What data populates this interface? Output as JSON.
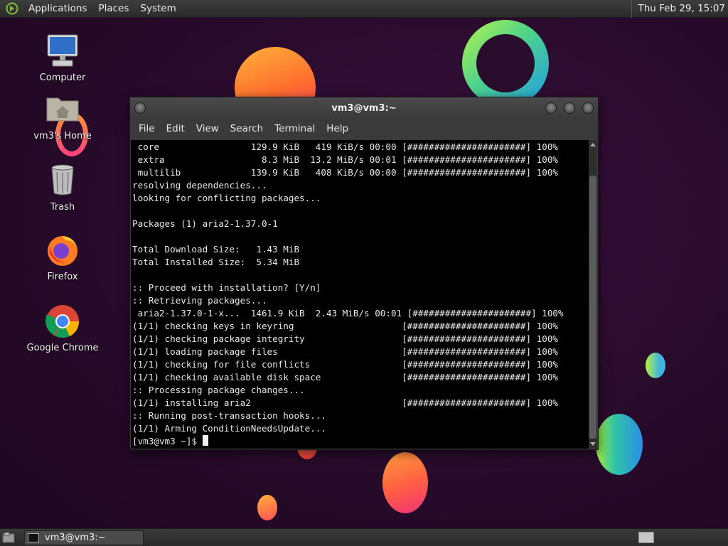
{
  "top_panel": {
    "menus": [
      "Applications",
      "Places",
      "System"
    ],
    "clock": "Thu Feb 29, 15:07"
  },
  "desktop": {
    "icons": [
      {
        "label": "Computer",
        "icon": "computer-icon"
      },
      {
        "label": "vm3's Home",
        "icon": "home-folder-icon"
      },
      {
        "label": "Trash",
        "icon": "trash-icon"
      },
      {
        "label": "Firefox",
        "icon": "firefox-icon"
      },
      {
        "label": "Google Chrome",
        "icon": "chrome-icon"
      }
    ]
  },
  "terminal": {
    "title": "vm3@vm3:~",
    "menu": [
      "File",
      "Edit",
      "View",
      "Search",
      "Terminal",
      "Help"
    ],
    "lines": [
      " core                 129.9 KiB   419 KiB/s 00:00 [######################] 100%",
      " extra                  8.3 MiB  13.2 MiB/s 00:01 [######################] 100%",
      " multilib             139.9 KiB   408 KiB/s 00:00 [######################] 100%",
      "resolving dependencies...",
      "looking for conflicting packages...",
      "",
      "Packages (1) aria2-1.37.0-1",
      "",
      "Total Download Size:   1.43 MiB",
      "Total Installed Size:  5.34 MiB",
      "",
      ":: Proceed with installation? [Y/n]",
      ":: Retrieving packages...",
      " aria2-1.37.0-1-x...  1461.9 KiB  2.43 MiB/s 00:01 [######################] 100%",
      "(1/1) checking keys in keyring                    [######################] 100%",
      "(1/1) checking package integrity                  [######################] 100%",
      "(1/1) loading package files                       [######################] 100%",
      "(1/1) checking for file conflicts                 [######################] 100%",
      "(1/1) checking available disk space               [######################] 100%",
      ":: Processing package changes...",
      "(1/1) installing aria2                            [######################] 100%",
      ":: Running post-transaction hooks...",
      "(1/1) Arming ConditionNeedsUpdate..."
    ],
    "prompt": "[vm3@vm3 ~]$ "
  },
  "taskbar": {
    "tasks": [
      {
        "label": "vm3@vm3:~"
      }
    ]
  }
}
